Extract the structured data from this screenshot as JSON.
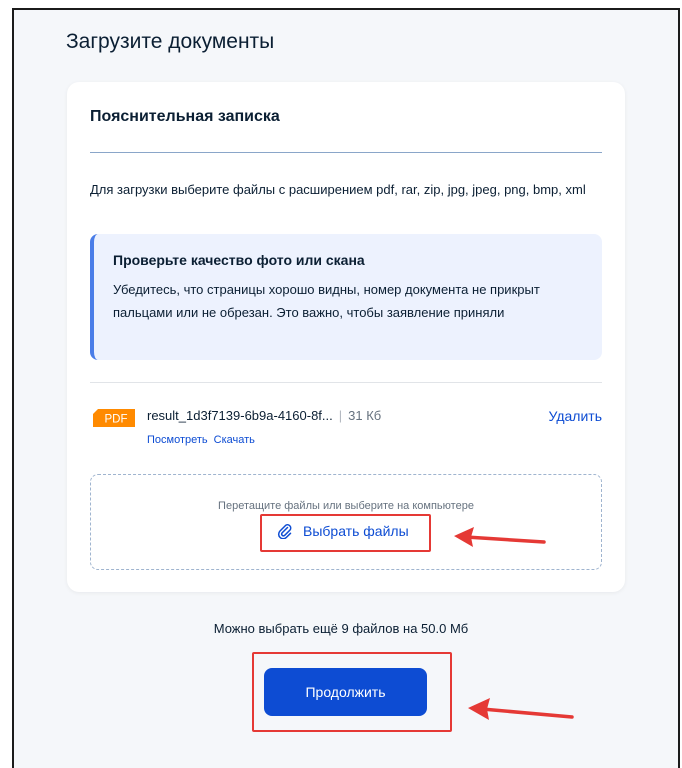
{
  "page": {
    "title": "Загрузите документы"
  },
  "card": {
    "title": "Пояснительная записка",
    "hint": "Для загрузки выберите файлы с расширением pdf, rar, zip, jpg, jpeg, png, bmp, xml",
    "notice": {
      "title": "Проверьте качество фото или скана",
      "text": "Убедитесь, что страницы хорошо видны, номер документа не прикрыт пальцами или не обрезан. Это важно, чтобы заявление приняли"
    },
    "file": {
      "badge": "PDF",
      "name": "result_1d3f7139-6b9a-4160-8f...",
      "separator": "|",
      "size": "31 Кб",
      "delete_label": "Удалить",
      "view_label": "Посмотреть",
      "download_label": "Скачать"
    },
    "dropzone": {
      "hint": "Перетащите файлы или выберите на компьютере",
      "choose_label": "Выбрать файлы"
    }
  },
  "limit_text": "Можно выбрать ещё 9 файлов на 50.0 Мб",
  "continue_label": "Продолжить",
  "colors": {
    "accent": "#0d4cd3",
    "notice_bg": "#edf2fe",
    "notice_border": "#4a7de8",
    "pdf_badge": "#ff8a00",
    "annotation": "#e53935"
  },
  "icons": [
    "pdf-badge-icon",
    "paperclip-icon",
    "arrow-annotation"
  ]
}
